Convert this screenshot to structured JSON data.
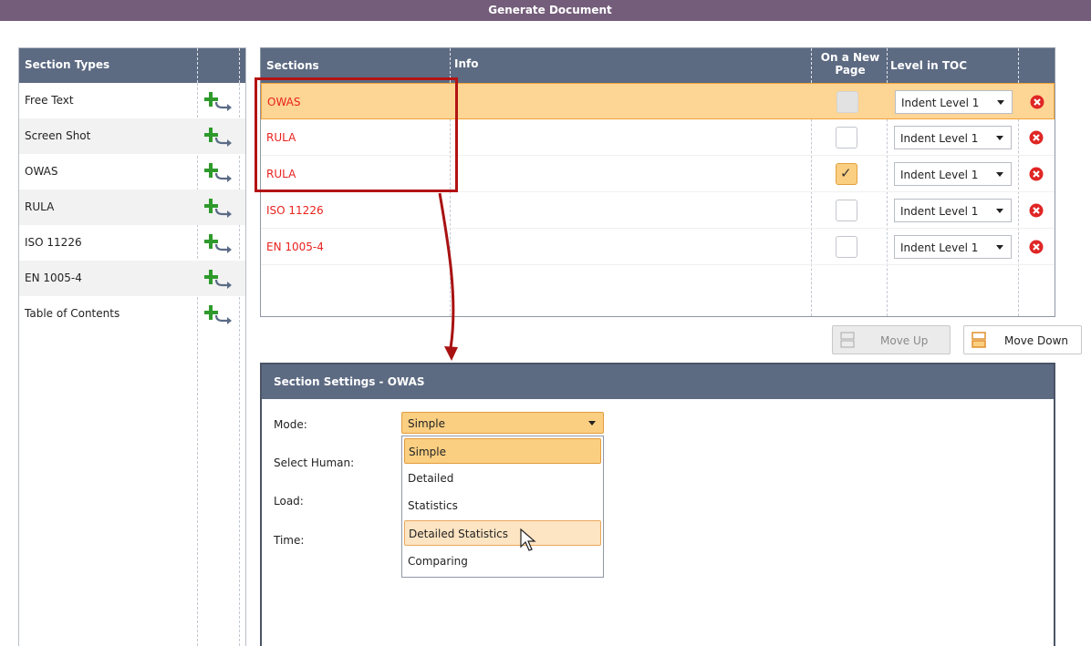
{
  "window": {
    "title": "Generate Document"
  },
  "section_types": {
    "header": "Section Types",
    "items": [
      {
        "label": "Free Text",
        "action_icon": "add-arrow-icon"
      },
      {
        "label": "Screen Shot",
        "action_icon": "add-arrow-icon"
      },
      {
        "label": "OWAS",
        "action_icon": "add-arrow-icon"
      },
      {
        "label": "RULA",
        "action_icon": "add-arrow-icon"
      },
      {
        "label": "ISO 11226",
        "action_icon": "add-arrow-icon"
      },
      {
        "label": "EN 1005-4",
        "action_icon": "add-arrow-icon"
      },
      {
        "label": "Table of Contents",
        "action_icon": "add-arrow-icon"
      }
    ]
  },
  "sections": {
    "columns": {
      "sections": "Sections",
      "info": "Info",
      "new_page_line1": "On a New",
      "new_page_line2": "Page",
      "level": "Level in TOC"
    },
    "rows": [
      {
        "name": "OWAS",
        "info": "",
        "new_page": "disabled",
        "level": "Indent Level 1",
        "selected": true
      },
      {
        "name": "RULA",
        "info": "",
        "new_page": "unchecked",
        "level": "Indent Level 1",
        "selected": false
      },
      {
        "name": "RULA",
        "info": "",
        "new_page": "checked",
        "level": "Indent Level 1",
        "selected": false
      },
      {
        "name": "ISO 11226",
        "info": "",
        "new_page": "unchecked",
        "level": "Indent Level 1",
        "selected": false
      },
      {
        "name": "EN 1005-4",
        "info": "",
        "new_page": "unchecked",
        "level": "Indent Level 1",
        "selected": false
      }
    ]
  },
  "buttons": {
    "move_up": "Move Up",
    "move_down": "Move Down"
  },
  "settings": {
    "header": "Section Settings - OWAS",
    "labels": {
      "mode": "Mode:",
      "human": "Select Human:",
      "load": "Load:",
      "time": "Time:"
    },
    "mode_value": "Simple",
    "mode_options": [
      "Simple",
      "Detailed",
      "Statistics",
      "Detailed Statistics",
      "Comparing"
    ],
    "mode_selected": "Simple",
    "mode_hovered": "Detailed Statistics"
  },
  "colors": {
    "header": "#5c6a82",
    "title_bar": "#745d7a",
    "selection": "#fdd594",
    "section_text": "#e8221e",
    "annotation": "#b31313"
  }
}
